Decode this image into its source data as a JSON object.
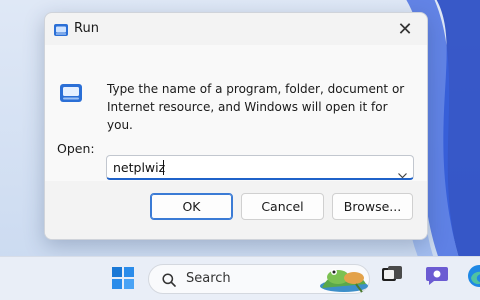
{
  "dialog": {
    "title": "Run",
    "message": "Type the name of a program, folder, document or Internet resource, and Windows will open it for you.",
    "open_label": "Open:",
    "open_value": "netplwiz",
    "ok_label": "OK",
    "cancel_label": "Cancel",
    "browse_label": "Browse..."
  },
  "taskbar": {
    "search_label": "Search"
  },
  "icons": {
    "app": "run-app-icon",
    "close": "close-icon",
    "run": "run-icon",
    "chevron": "chevron-down-icon",
    "start": "windows-start-icon",
    "search": "search-icon",
    "search_highlight": "frog-illustration",
    "task_view": "task-view-icon",
    "chat": "chat-icon",
    "edge": "edge-icon"
  },
  "colors": {
    "accent": "#1f62c9",
    "dialog_bg": "#f3f3f3",
    "taskbar_bg": "#e9eef7"
  }
}
